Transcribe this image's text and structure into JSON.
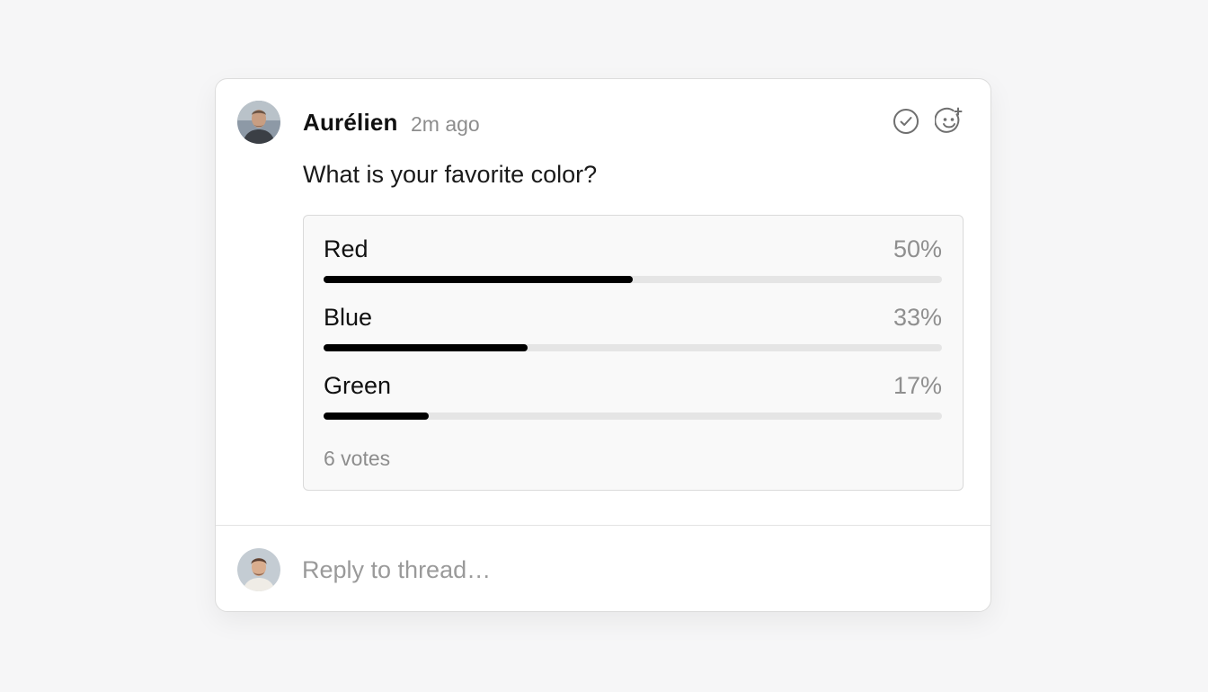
{
  "thread": {
    "author": {
      "name": "Aurélien",
      "timestamp": "2m ago",
      "avatar_icon": "avatar-photo"
    },
    "actions": {
      "resolve_icon": "check-circle-icon",
      "reaction_icon": "emoji-add-icon"
    },
    "message": "What is your favorite color?",
    "poll": {
      "options": [
        {
          "label": "Red",
          "percent_label": "50%",
          "percent": 50
        },
        {
          "label": "Blue",
          "percent_label": "33%",
          "percent": 33
        },
        {
          "label": "Green",
          "percent_label": "17%",
          "percent": 17
        }
      ],
      "votes_label": "6 votes",
      "bar_color": "#000000",
      "track_color": "#e5e5e5"
    },
    "reply": {
      "placeholder": "Reply to thread…",
      "value": ""
    }
  }
}
